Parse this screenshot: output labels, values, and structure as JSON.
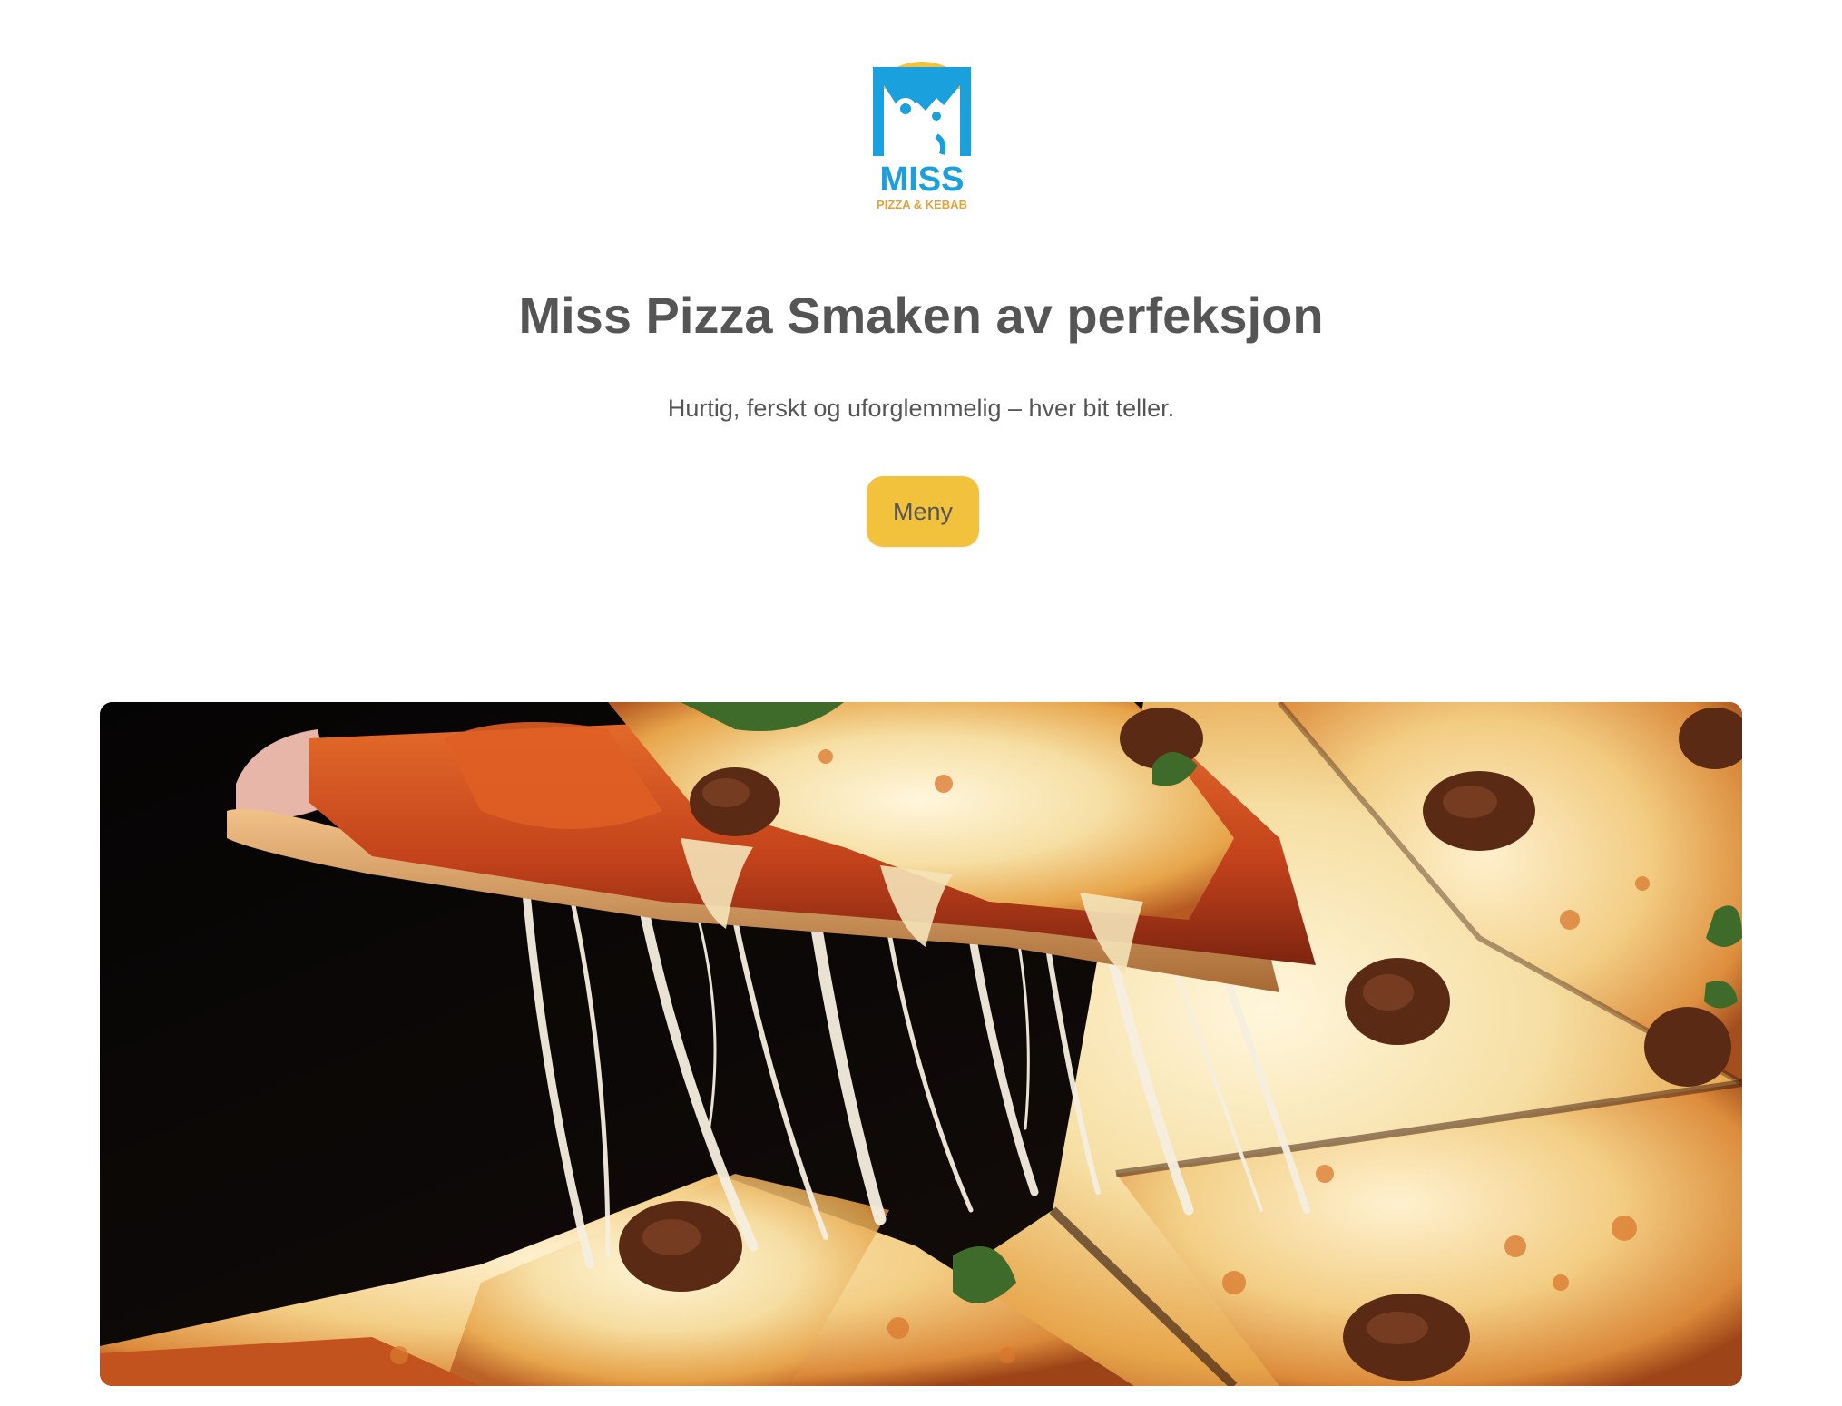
{
  "logo": {
    "brand": "MISS",
    "tagline": "PIZZA & KEBAB",
    "colors": {
      "blue": "#1aa1dd",
      "gold": "#f2c23d",
      "tagline": "#e4a33a"
    }
  },
  "hero": {
    "title": "Miss Pizza Smaken av perfeksjon",
    "subtitle": "Hurtig, ferskt og uforglemmelig – hver bit teller.",
    "cta_label": "Meny"
  },
  "image": {
    "subject": "pizza-slice-cheese-pull"
  },
  "colors": {
    "text": "#555555",
    "button": "#f2c23d",
    "background": "#ffffff"
  }
}
